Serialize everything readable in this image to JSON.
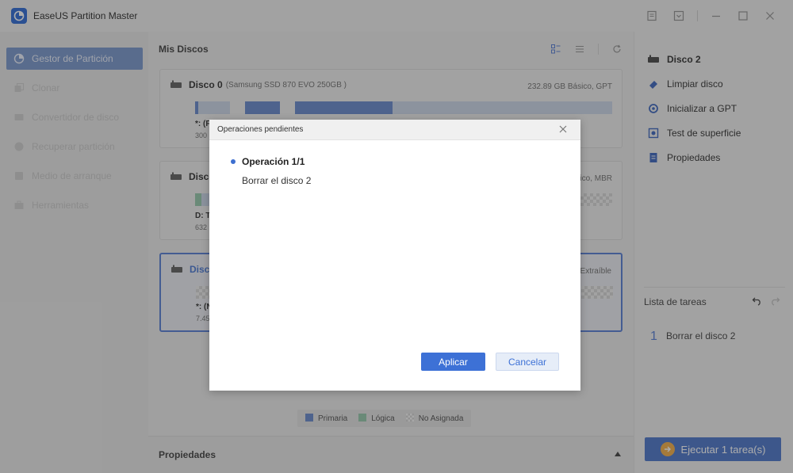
{
  "app": {
    "title": "EaseUS Partition Master",
    "brand_color": "#1f5fd1"
  },
  "title_controls": [
    {
      "icon": "notes-icon"
    },
    {
      "icon": "menu-dropdown-icon"
    },
    {
      "icon": "minimize-icon"
    },
    {
      "icon": "maximize-icon"
    },
    {
      "icon": "close-icon"
    }
  ],
  "sidebar": {
    "items": [
      {
        "label": "Gestor de Partición",
        "icon": "pie-chart-icon",
        "active": true
      },
      {
        "label": "Clonar",
        "icon": "clone-icon",
        "active": false
      },
      {
        "label": "Convertidor de disco",
        "icon": "disk-convert-icon",
        "active": false
      },
      {
        "label": "Recuperar partición",
        "icon": "recover-partition-icon",
        "active": false
      },
      {
        "label": "Medio de arranque",
        "icon": "boot-media-icon",
        "active": false
      },
      {
        "label": "Herramientas",
        "icon": "toolbox-icon",
        "active": false
      }
    ]
  },
  "main": {
    "title": "Mis Discos",
    "disks": [
      {
        "name": "Disco 0",
        "model": "(Samsung SSD 870 EVO 250GB )",
        "meta": "232.89 GB Básico, GPT",
        "partitions": [
          {
            "label": "*: (F",
            "size": "300"
          }
        ]
      },
      {
        "name": "Disco",
        "model": "",
        "meta": "asico, MBR",
        "partitions": [
          {
            "label": "D: T",
            "size": "632"
          }
        ]
      },
      {
        "name": "Disco",
        "model": "",
        "meta": "3 Extraíble",
        "selected": true,
        "partitions": [
          {
            "label": "*: (N",
            "size": "7.45"
          }
        ]
      }
    ],
    "legend": [
      {
        "label": "Primaria",
        "color": "#5c80c9"
      },
      {
        "label": "Lógica",
        "color": "#8cc3a4"
      },
      {
        "label": "No Asignada",
        "color": "#d2d2d2"
      }
    ],
    "properties_label": "Propiedades"
  },
  "right_panel": {
    "disk_title": "Disco 2",
    "actions": [
      {
        "label": "Limpiar disco",
        "icon": "eraser-icon"
      },
      {
        "label": "Inicializar a GPT",
        "icon": "initialize-icon"
      },
      {
        "label": "Test de superficie",
        "icon": "surface-test-icon"
      },
      {
        "label": "Propiedades",
        "icon": "properties-icon"
      }
    ],
    "tasks_title": "Lista de tareas",
    "tasks": [
      {
        "number": "1",
        "text": "Borrar el disco 2"
      }
    ],
    "execute_label": "Ejecutar 1 tarea(s)"
  },
  "modal": {
    "title": "Operaciones pendientes",
    "operation_title": "Operación 1/1",
    "operation_desc": "Borrar el disco 2",
    "apply_label": "Aplicar",
    "cancel_label": "Cancelar"
  }
}
